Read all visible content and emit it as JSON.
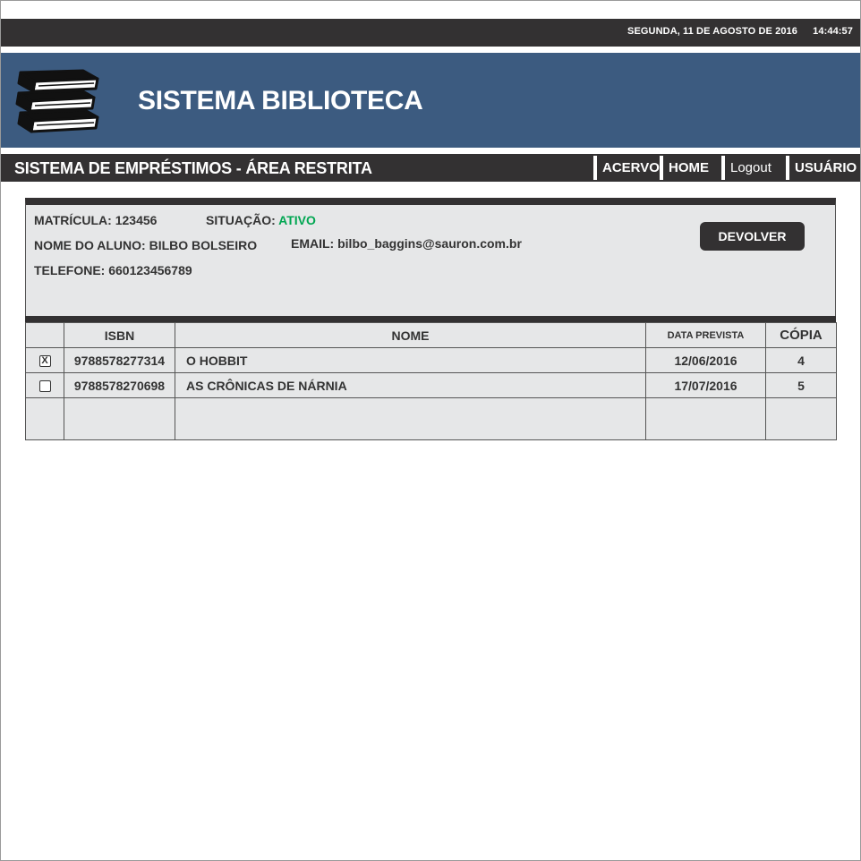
{
  "topbar": {
    "date": "SEGUNDA, 11 DE AGOSTO DE 2016",
    "time": "14:44:57"
  },
  "header": {
    "title": "SISTEMA BIBLIOTECA",
    "logo_icon": "books-stack-icon"
  },
  "navbar": {
    "section_title": "SISTEMA DE EMPRÉSTIMOS - ÁREA RESTRITA",
    "items": [
      {
        "label": "ACERVO"
      },
      {
        "label": "HOME"
      },
      {
        "label": "Logout"
      },
      {
        "label": "USUÁRIO"
      }
    ]
  },
  "student": {
    "matricula_label": "MATRÍCULA:",
    "matricula": "123456",
    "situacao_label": "SITUAÇÃO:",
    "situacao": "ATIVO",
    "nome_label": "NOME DO ALUNO:",
    "nome": "BILBO BOLSEIRO",
    "email_label": "EMAIL:",
    "email": "bilbo_baggins@sauron.com.br",
    "telefone_label": "TELEFONE:",
    "telefone": "660123456789",
    "return_button": "DEVOLVER"
  },
  "loans": {
    "columns": {
      "isbn": "ISBN",
      "nome": "NOME",
      "data": "DATA PREVISTA",
      "copia": "CÓPIA"
    },
    "rows": [
      {
        "checked": true,
        "check_mark": "X",
        "isbn": "9788578277314",
        "nome": "O HOBBIT",
        "data": "12/06/2016",
        "copia": "4"
      },
      {
        "checked": false,
        "check_mark": "",
        "isbn": "9788578270698",
        "nome": "AS CRÔNICAS DE NÁRNIA",
        "data": "17/07/2016",
        "copia": "5"
      }
    ]
  },
  "colors": {
    "dark_bar": "#333132",
    "header_blue": "#3c5b80",
    "panel_gray": "#e6e7e8",
    "status_green": "#00a651"
  }
}
